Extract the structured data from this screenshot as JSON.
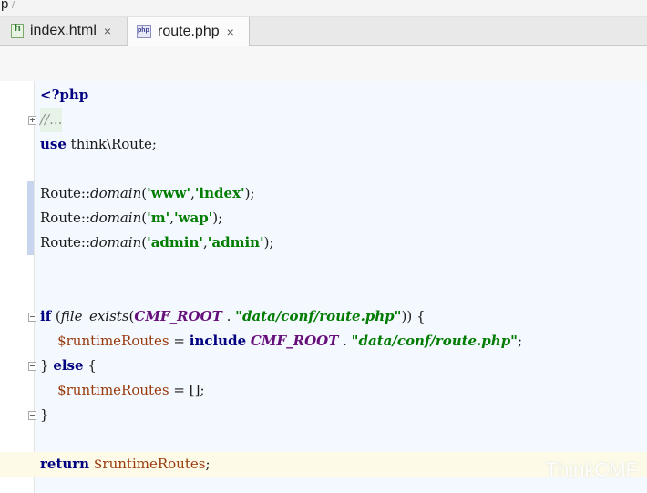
{
  "breadcrumb": {
    "text": "p",
    "separator": "/"
  },
  "tabs": [
    {
      "label": "index.html",
      "close": "×",
      "icon": "html-file-icon"
    },
    {
      "label": "route.php",
      "close": "×",
      "icon": "php-file-icon",
      "active": true
    }
  ],
  "code": {
    "l1": {
      "a": "<?php"
    },
    "l2": {
      "a": "//..."
    },
    "l3": {
      "a": "use",
      "b": " think\\Route;"
    },
    "l5": {
      "a": "Route::",
      "b": "domain",
      "c": "(",
      "d": "'www'",
      "e": ",",
      "f": "'index'",
      "g": ");"
    },
    "l6": {
      "a": "Route::",
      "b": "domain",
      "c": "(",
      "d": "'m'",
      "e": ",",
      "f": "'wap'",
      "g": ");"
    },
    "l7": {
      "a": "Route::",
      "b": "domain",
      "c": "(",
      "d": "'admin'",
      "e": ",",
      "f": "'admin'",
      "g": ");"
    },
    "l10": {
      "a": "if",
      "b": " (",
      "c": "file_exists",
      "d": "(",
      "e": "CMF_ROOT",
      "f": " . ",
      "g": "\"data/conf/route.php\"",
      "h": ")) {"
    },
    "l11": {
      "a": "    ",
      "b": "$runtimeRoutes",
      "c": " = ",
      "d": "include",
      "e": " ",
      "f": "CMF_ROOT",
      "g": " . ",
      "h": "\"data/conf/route.php\"",
      "i": ";"
    },
    "l12": {
      "a": "} ",
      "b": "else",
      "c": " {"
    },
    "l13": {
      "a": "    ",
      "b": "$runtimeRoutes",
      "c": " = [];"
    },
    "l14": {
      "a": "}"
    },
    "l16": {
      "a": "return",
      "b": " ",
      "c": "$runtimeRoutes",
      "d": ";"
    }
  },
  "watermark": "ThinkCMF"
}
